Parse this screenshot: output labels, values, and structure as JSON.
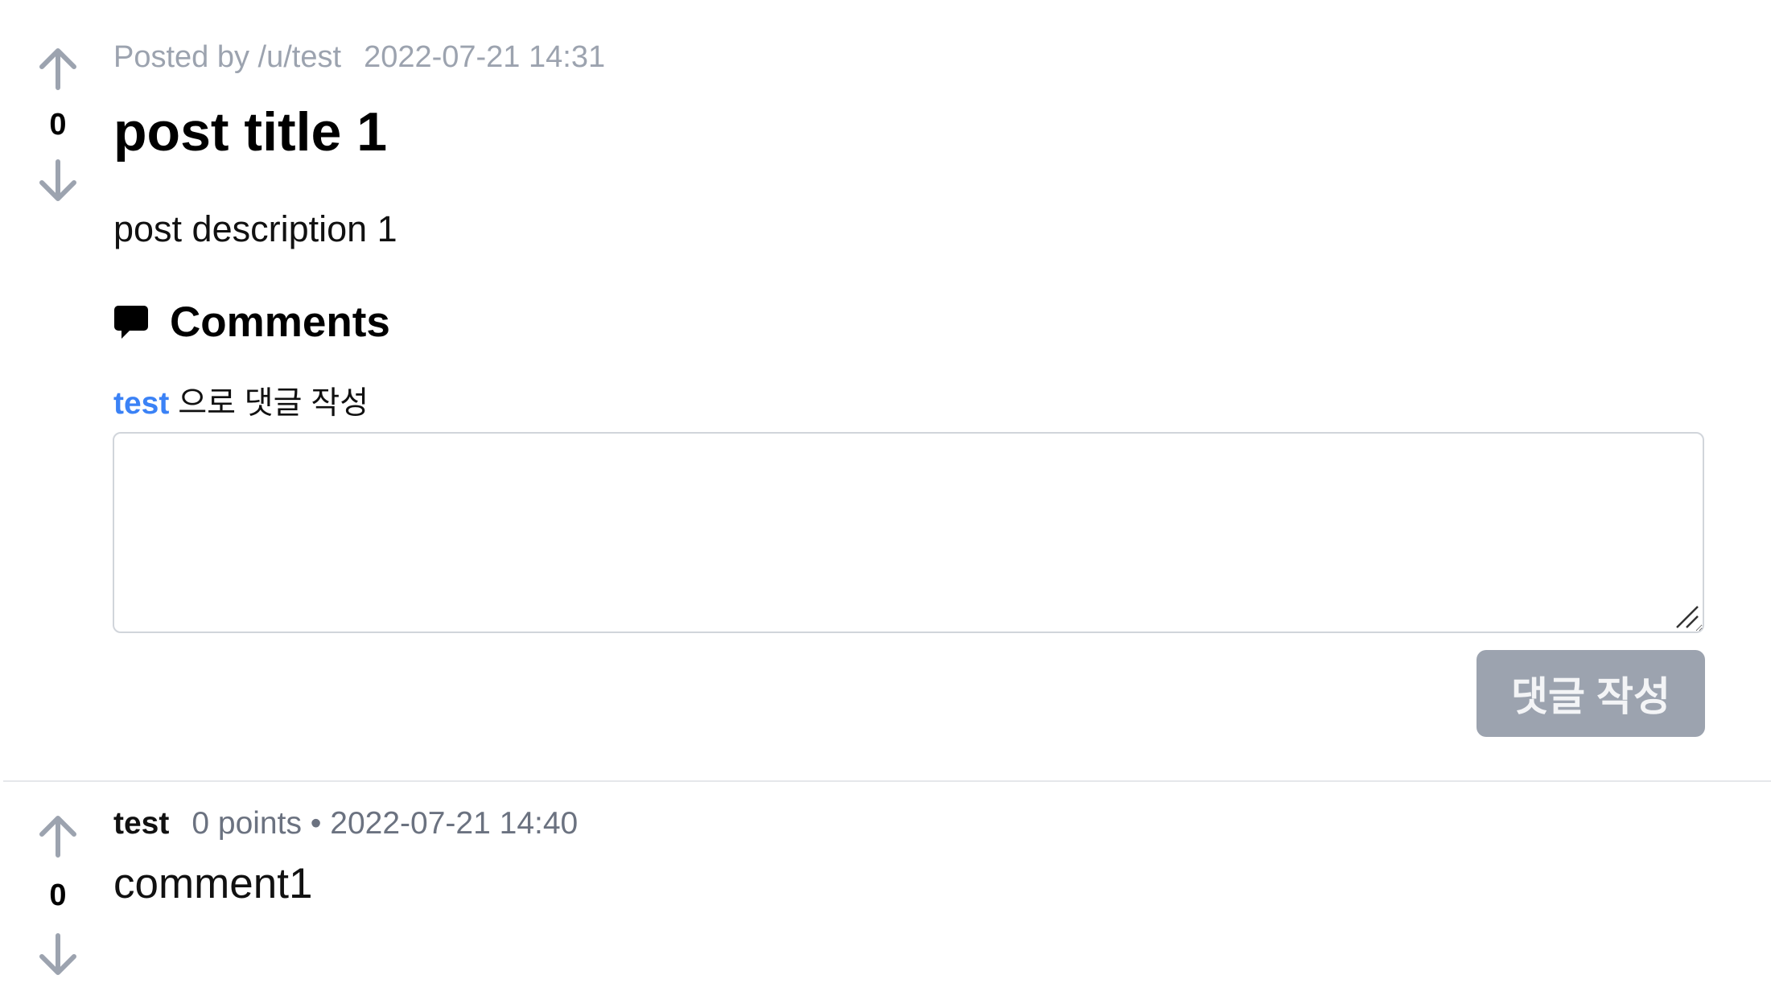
{
  "post": {
    "votes": "0",
    "posted_by": "Posted by /u/test",
    "timestamp": "2022-07-21 14:31",
    "title": "post title 1",
    "description": "post description 1"
  },
  "comments_section": {
    "heading": "Comments",
    "write_as_user": "test",
    "write_as_suffix": " 으로 댓글 작성",
    "textarea_value": "",
    "submit_label": "댓글 작성"
  },
  "comment": {
    "votes": "0",
    "author": "test",
    "points": "0 points",
    "separator": " • ",
    "timestamp": "2022-07-21 14:40",
    "body": "comment1"
  },
  "icons": {
    "upvote": "arrow-up-icon",
    "downvote": "arrow-down-icon",
    "comments": "chat-bubble-icon"
  },
  "colors": {
    "link_blue": "#3b82f6",
    "muted_gray": "#9ca3af",
    "button_bg": "#9ca3af"
  }
}
